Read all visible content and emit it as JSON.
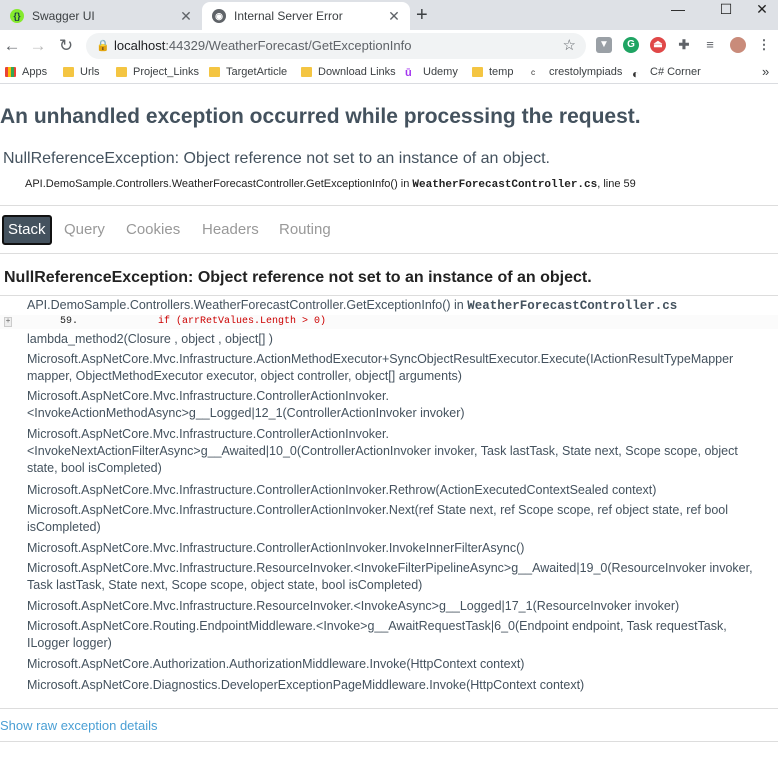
{
  "browser": {
    "tabs": [
      {
        "title": "Swagger UI",
        "active": false
      },
      {
        "title": "Internal Server Error",
        "active": true
      }
    ],
    "url": {
      "host": "localhost",
      "path": ":44329/WeatherForecast/GetExceptionInfo"
    },
    "bookmarks": [
      "Apps",
      "Urls",
      "Project_Links",
      "TargetArticle",
      "Download Links",
      "Udemy",
      "temp",
      "crestolympiads",
      "C# Corner"
    ],
    "more_bookmarks": "»"
  },
  "error_page": {
    "title": "An unhandled exception occurred while processing the request.",
    "exception_message": "NullReferenceException: Object reference not set to an instance of an object.",
    "location": {
      "method": "API.DemoSample.Controllers.WeatherForecastController.GetExceptionInfo() in ",
      "file": "WeatherForecastController.cs",
      "line": ", line 59"
    },
    "tabs": [
      "Stack",
      "Query",
      "Cookies",
      "Headers",
      "Routing"
    ],
    "active_tab": "Stack",
    "stack_heading": "NullReferenceException: Object reference not set to an instance of an object.",
    "first_frame": {
      "method": "API.DemoSample.Controllers.WeatherForecastController.GetExceptionInfo() in ",
      "file": "WeatherForecastController.cs",
      "line_number": "59.",
      "code": "if (arrRetValues.Length > 0)",
      "expander": "+"
    },
    "frames": [
      "lambda_method2(Closure , object , object[] )",
      "Microsoft.AspNetCore.Mvc.Infrastructure.ActionMethodExecutor+SyncObjectResultExecutor.Execute(IActionResultTypeMapper mapper, ObjectMethodExecutor executor, object controller, object[] arguments)",
      "Microsoft.AspNetCore.Mvc.Infrastructure.ControllerActionInvoker.<InvokeActionMethodAsync>g__Logged|12_1(ControllerActionInvoker invoker)",
      "Microsoft.AspNetCore.Mvc.Infrastructure.ControllerActionInvoker.<InvokeNextActionFilterAsync>g__Awaited|10_0(ControllerActionInvoker invoker, Task lastTask, State next, Scope scope, object state, bool isCompleted)",
      "Microsoft.AspNetCore.Mvc.Infrastructure.ControllerActionInvoker.Rethrow(ActionExecutedContextSealed context)",
      "Microsoft.AspNetCore.Mvc.Infrastructure.ControllerActionInvoker.Next(ref State next, ref Scope scope, ref object state, ref bool isCompleted)",
      "Microsoft.AspNetCore.Mvc.Infrastructure.ControllerActionInvoker.InvokeInnerFilterAsync()",
      "Microsoft.AspNetCore.Mvc.Infrastructure.ResourceInvoker.<InvokeFilterPipelineAsync>g__Awaited|19_0(ResourceInvoker invoker, Task lastTask, State next, Scope scope, object state, bool isCompleted)",
      "Microsoft.AspNetCore.Mvc.Infrastructure.ResourceInvoker.<InvokeAsync>g__Logged|17_1(ResourceInvoker invoker)",
      "Microsoft.AspNetCore.Routing.EndpointMiddleware.<Invoke>g__AwaitRequestTask|6_0(Endpoint endpoint, Task requestTask, ILogger logger)",
      "Microsoft.AspNetCore.Authorization.AuthorizationMiddleware.Invoke(HttpContext context)",
      "Microsoft.AspNetCore.Diagnostics.DeveloperExceptionPageMiddleware.Invoke(HttpContext context)"
    ],
    "raw_link": "Show raw exception details"
  },
  "colors": {
    "heading": "#44525e",
    "link": "#4a9fd4",
    "code": "#c00"
  }
}
